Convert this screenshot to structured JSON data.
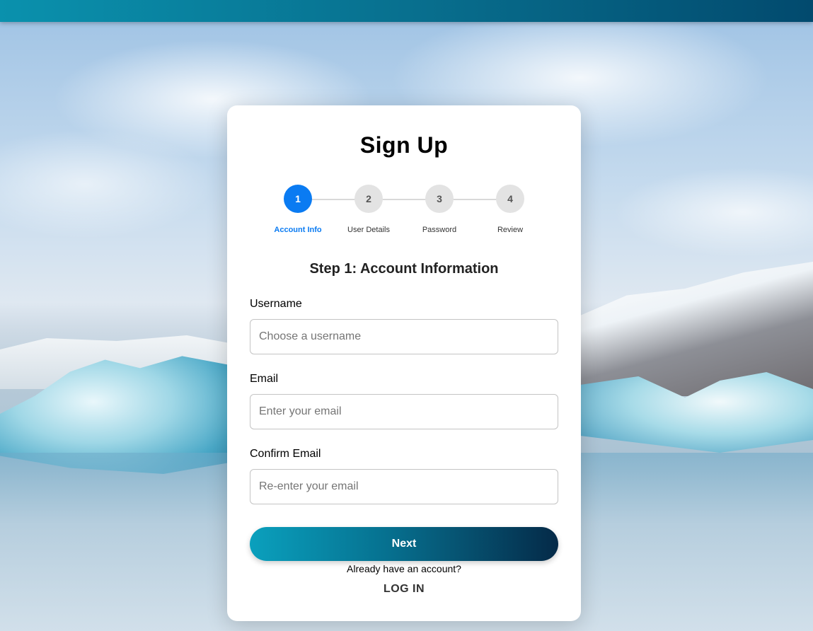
{
  "form": {
    "title": "Sign Up",
    "steps": [
      {
        "number": "1",
        "label": "Account Info",
        "active": true
      },
      {
        "number": "2",
        "label": "User Details",
        "active": false
      },
      {
        "number": "3",
        "label": "Password",
        "active": false
      },
      {
        "number": "4",
        "label": "Review",
        "active": false
      }
    ],
    "step_title": "Step 1: Account Information",
    "fields": {
      "username": {
        "label": "Username",
        "placeholder": "Choose a username",
        "value": ""
      },
      "email": {
        "label": "Email",
        "placeholder": "Enter your email",
        "value": ""
      },
      "confirm_email": {
        "label": "Confirm Email",
        "placeholder": "Re-enter your email",
        "value": ""
      }
    },
    "next_label": "Next",
    "login_prompt": "Already have an account?",
    "login_label": "LOG IN"
  },
  "colors": {
    "accent": "#0a7bf2",
    "button_gradient_start": "#0aa0bd",
    "button_gradient_end": "#052a48",
    "topbar": "#08708f"
  }
}
